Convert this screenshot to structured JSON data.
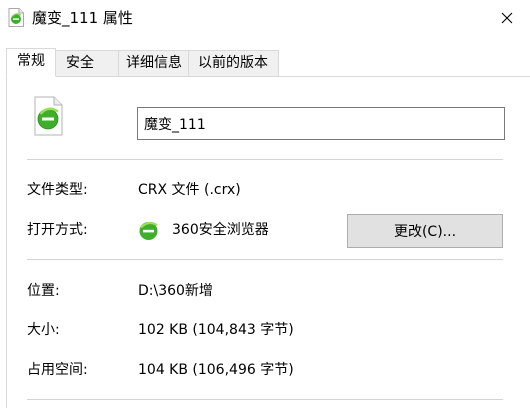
{
  "window": {
    "title": "魔变_111 属性",
    "icon": "ie-file-icon"
  },
  "tabs": [
    {
      "label": "常规",
      "active": true
    },
    {
      "label": "安全",
      "active": false
    },
    {
      "label": "详细信息",
      "active": false
    },
    {
      "label": "以前的版本",
      "active": false
    }
  ],
  "general": {
    "file_name": "魔变_111",
    "file_type_label": "文件类型:",
    "file_type_value": "CRX 文件 (.crx)",
    "open_with_label": "打开方式:",
    "open_with_app": "360安全浏览器",
    "change_button": "更改(C)...",
    "location_label": "位置:",
    "location_value": "D:\\360新增",
    "size_label": "大小:",
    "size_value": "102 KB (104,843 字节)",
    "disk_size_label": "占用空间:",
    "disk_size_value": "104 KB (106,496 字节)"
  },
  "colors": {
    "icon_green": "#3fae2a",
    "button_bg": "#e1e1e1",
    "separator": "#d4d4d4"
  }
}
